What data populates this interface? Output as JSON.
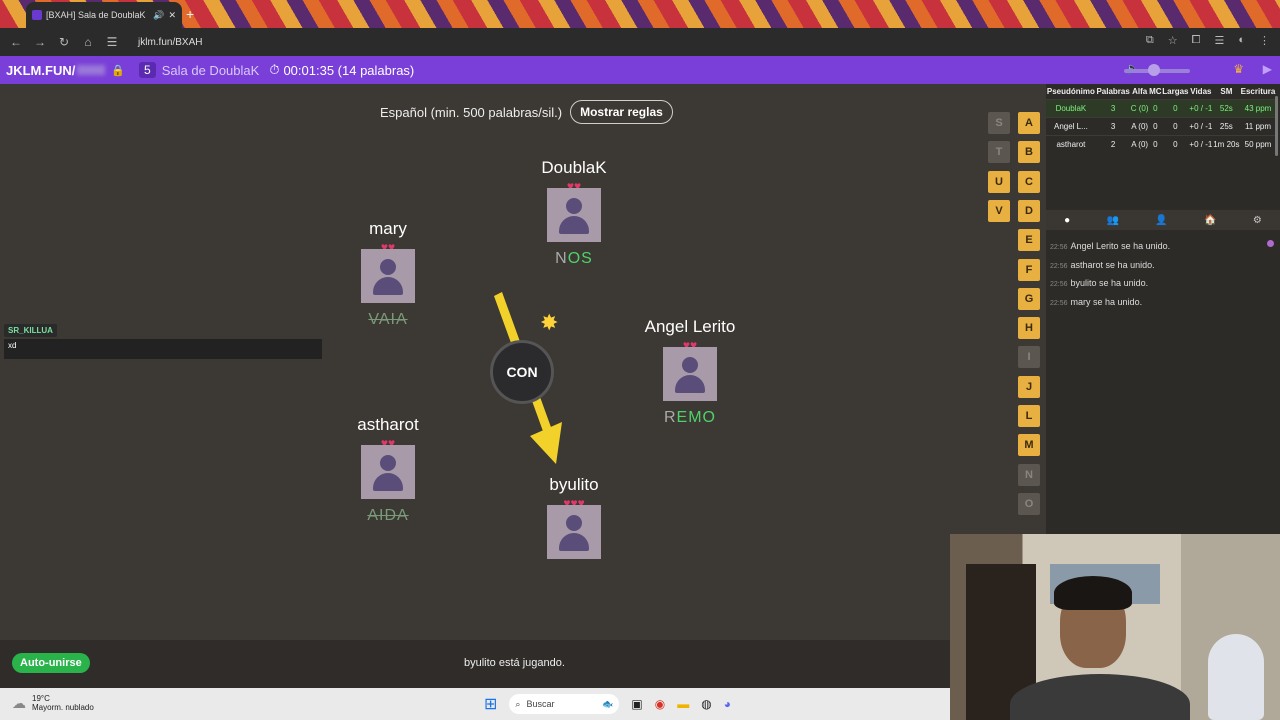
{
  "browser": {
    "tab_title": "[BXAH] Sala de DoublaK",
    "url": "jklm.fun/BXAH"
  },
  "game_bar": {
    "brand": "JKLM.FUN/",
    "room_number": "5",
    "room_name": "Sala de DoublaK",
    "timer": "00:01:35 (14 palabras)"
  },
  "rules": {
    "language_text": "Español (min. 500 palabras/sil.)",
    "button_label": "Mostrar reglas"
  },
  "players": [
    {
      "name": "DoublaK",
      "hearts": "♥♥",
      "word_typed": "N",
      "word_rest": "OS",
      "struck": false
    },
    {
      "name": "mary",
      "hearts": "♥♥",
      "word_typed": "",
      "word_rest": "VAIA",
      "struck": true
    },
    {
      "name": "Angel Lerito",
      "hearts": "♥♥",
      "word_typed": "R",
      "word_rest": "EMO",
      "struck": false
    },
    {
      "name": "astharot",
      "hearts": "♥♥",
      "word_typed": "",
      "word_rest": "AIDA",
      "struck": true
    },
    {
      "name": "byulito",
      "hearts": "♥♥♥",
      "word_typed": "",
      "word_rest": "",
      "struck": false
    }
  ],
  "bomb": {
    "syllable": "CON"
  },
  "chat_overlay": {
    "user": "SR_KILLUA",
    "message": "xd"
  },
  "letters": {
    "left": [
      {
        "l": "S",
        "on": false
      },
      {
        "l": "T",
        "on": false
      },
      {
        "l": "U",
        "on": true
      },
      {
        "l": "V",
        "on": true
      }
    ],
    "right": [
      {
        "l": "A",
        "on": true
      },
      {
        "l": "B",
        "on": true
      },
      {
        "l": "C",
        "on": true
      },
      {
        "l": "D",
        "on": true
      },
      {
        "l": "E",
        "on": true
      },
      {
        "l": "F",
        "on": true
      },
      {
        "l": "G",
        "on": true
      },
      {
        "l": "H",
        "on": true
      },
      {
        "l": "I",
        "on": false
      },
      {
        "l": "J",
        "on": true
      },
      {
        "l": "L",
        "on": true
      },
      {
        "l": "M",
        "on": true
      },
      {
        "l": "N",
        "on": false
      },
      {
        "l": "O",
        "on": false
      }
    ]
  },
  "stats": {
    "headers": [
      "Pseudónimo",
      "Palabras",
      "Alfa",
      "MC",
      "Largas",
      "Vidas",
      "SM",
      "Escritura"
    ],
    "rows": [
      [
        "DoublaK",
        "3",
        "C (0)",
        "0",
        "0",
        "+0 / -1",
        "52s",
        "43 ppm"
      ],
      [
        "Angel L...",
        "3",
        "A (0)",
        "0",
        "0",
        "+0 / -1",
        "25s",
        "11 ppm"
      ],
      [
        "astharot",
        "2",
        "A (0)",
        "0",
        "0",
        "+0 / -1",
        "1m 20s",
        "50 ppm"
      ]
    ]
  },
  "chat_log": [
    {
      "time": "22:56",
      "text": "Angel Lerito se ha unido."
    },
    {
      "time": "22:56",
      "text": "astharot se ha unido."
    },
    {
      "time": "22:56",
      "text": "byulito se ha unido."
    },
    {
      "time": "22:56",
      "text": "mary se ha unido."
    }
  ],
  "bottom": {
    "autojoin_label": "Auto-unirse",
    "status": "byulito está jugando."
  },
  "taskbar": {
    "temp": "19°C",
    "weather": "Mayorm. nublado",
    "search_placeholder": "Buscar"
  },
  "colors": {
    "accent": "#7a3fd8",
    "word_ok": "#4fd16a",
    "heart": "#e0386a",
    "letter_on": "#e8b040"
  }
}
